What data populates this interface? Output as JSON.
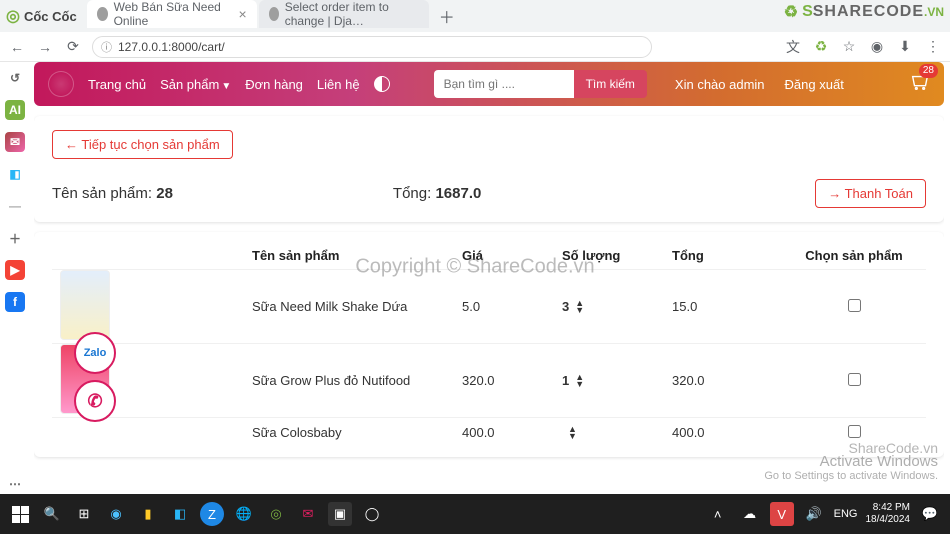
{
  "browser": {
    "brand": "Cốc Cốc",
    "tabs": [
      {
        "title": "Web Bán Sữa Need Online",
        "active": true
      },
      {
        "title": "Select order item to change | Dja…",
        "active": false
      }
    ],
    "url": "127.0.0.1:8000/cart/"
  },
  "watermark": {
    "top": "SHARECODE",
    "top_suffix": ".VN",
    "center": "Copyright © ShareCode.vn",
    "br_line1": "Activate Windows",
    "br_line2": "Go to Settings to activate Windows.",
    "br_brand": "ShareCode.vn"
  },
  "nav": {
    "home": "Trang chủ",
    "products": "Sản phẩm",
    "orders": "Đơn hàng",
    "contact": "Liên hệ",
    "search_placeholder": "Bạn tìm gì ....",
    "search_btn": "Tìm kiếm",
    "greeting": "Xin chào admin",
    "logout": "Đăng xuất",
    "cart_badge": "28"
  },
  "cart": {
    "continue_btn": "← Tiếp tục chọn sản phẩm",
    "count_label": "Tên sản phẩm:",
    "count_value": "28",
    "total_label": "Tổng:",
    "total_value": "1687.0",
    "checkout_btn": "→ Thanh Toán",
    "headers": {
      "name": "Tên sản phẩm",
      "price": "Giá",
      "qty": "Số lượng",
      "total": "Tổng",
      "select": "Chọn sản phẩm"
    },
    "items": [
      {
        "name": "Sữa Need Milk Shake Dứa",
        "price": "5.0",
        "qty": "3",
        "total": "15.0"
      },
      {
        "name": "Sữa Grow Plus đỏ Nutifood",
        "price": "320.0",
        "qty": "1",
        "total": "320.0"
      },
      {
        "name": "Sữa Colosbaby",
        "price": "400.0",
        "qty": "",
        "total": "400.0"
      }
    ]
  },
  "float": {
    "zalo": "Zalo",
    "call": "✆"
  },
  "taskbar": {
    "lang": "ENG",
    "time": "8:42 PM",
    "date": "18/4/2024"
  }
}
